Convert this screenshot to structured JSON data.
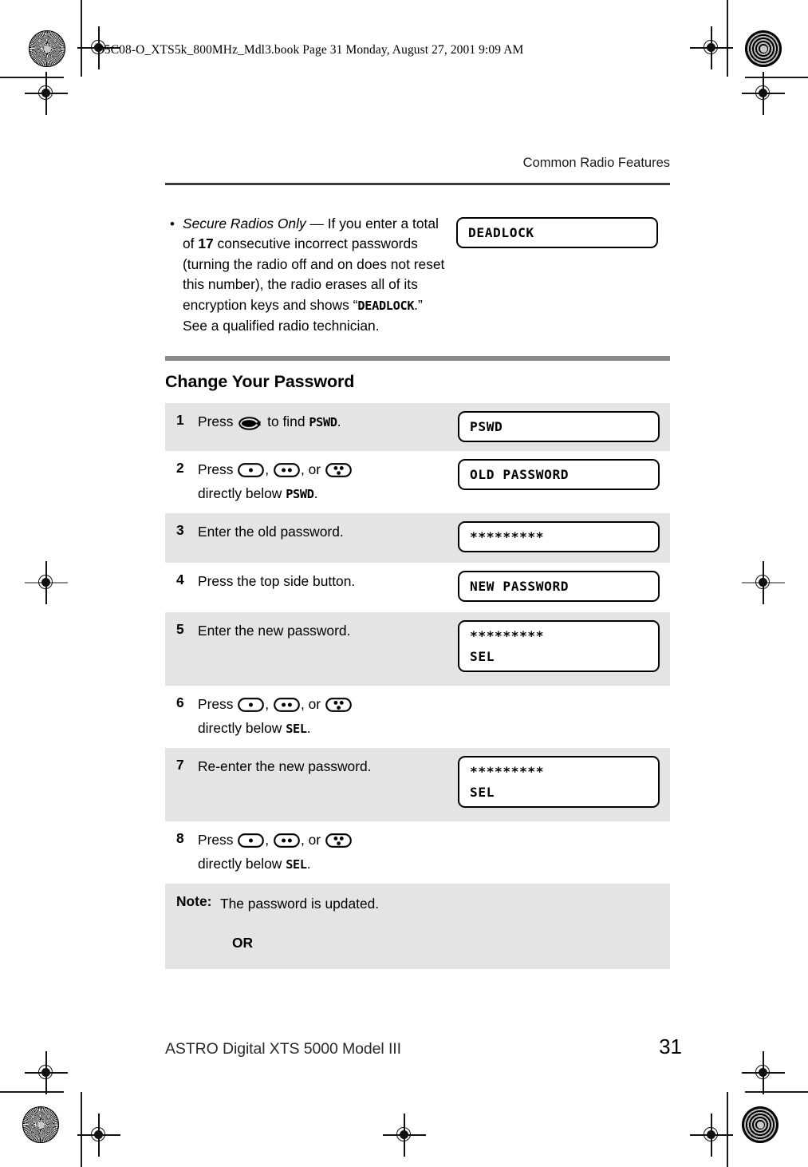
{
  "print_header": {
    "book_line": "95C08-O_XTS5k_800MHz_Mdl3.book  Page 31  Monday, August 27, 2001  9:09 AM"
  },
  "running_header": {
    "title": "Common Radio Features"
  },
  "bullet": {
    "marker": "•",
    "lead_italic": "Secure Radios Only",
    "dash": " — If you enter a total of ",
    "bold_number": "17",
    "mid": " consecutive incorrect passwords (turning the radio off and on does not reset this number), the radio erases all of its encryption keys and shows “",
    "lcd_word": "DEADLOCK",
    "tail": ".” See a qualified radio technician.",
    "display": "DEADLOCK"
  },
  "section": {
    "title": "Change Your Password"
  },
  "steps": [
    {
      "num": "1",
      "shaded": true,
      "text_parts": {
        "pre": "Press ",
        "icon": "menu-select-oval",
        "mid": " to find ",
        "lcd": "PSWD",
        "post": "."
      },
      "display": {
        "line1": "PSWD",
        "line2": ""
      }
    },
    {
      "num": "2",
      "shaded": false,
      "text_parts": {
        "pre": "Press ",
        "icons": [
          "one-dot-button",
          "two-dot-button",
          "three-dot-button"
        ],
        "mid": ", or ",
        "second_line_pre": "directly below ",
        "lcd": "PSWD",
        "post": "."
      },
      "display": {
        "line1": "OLD PASSWORD",
        "line2": ""
      }
    },
    {
      "num": "3",
      "shaded": true,
      "text": "Enter the old password.",
      "display": {
        "line1": "*********",
        "line2": ""
      }
    },
    {
      "num": "4",
      "shaded": false,
      "text": "Press the top side button.",
      "display": {
        "line1": "NEW PASSWORD",
        "line2": ""
      }
    },
    {
      "num": "5",
      "shaded": true,
      "text": "Enter the new password.",
      "display": {
        "line1": "*********",
        "line2": "SEL"
      }
    },
    {
      "num": "6",
      "shaded": false,
      "text_parts": {
        "pre": "Press ",
        "mid": ", or ",
        "second_line_pre": "directly below ",
        "lcd": "SEL",
        "post": "."
      },
      "display": {
        "line1": "",
        "line2": ""
      }
    },
    {
      "num": "7",
      "shaded": true,
      "text": "Re-enter the new password.",
      "display": {
        "line1": "*********",
        "line2": "SEL"
      }
    },
    {
      "num": "8",
      "shaded": false,
      "text_parts": {
        "pre": "Press ",
        "mid": ", or ",
        "second_line_pre": "directly below ",
        "lcd": "SEL",
        "post": "."
      },
      "display": {
        "line1": "",
        "line2": ""
      }
    }
  ],
  "note": {
    "label": "Note:",
    "body": "The password is updated.",
    "or": "OR"
  },
  "footer": {
    "title": "ASTRO Digital XTS 5000 Model III",
    "page": "31"
  },
  "icons": {
    "menu_select_oval": "menu-select-oval-icon",
    "one_dot": "one-dot-button-icon",
    "two_dot": "two-dot-button-icon",
    "three_dot": "three-dot-button-icon",
    "registration_target": "registration-target-icon",
    "rosette": "printer-rosette-icon"
  },
  "colors": {
    "shade_row": "#e4e4e4",
    "gray_bar": "#8a8a8a",
    "rule": "#3a3a3a",
    "text": "#000000"
  }
}
